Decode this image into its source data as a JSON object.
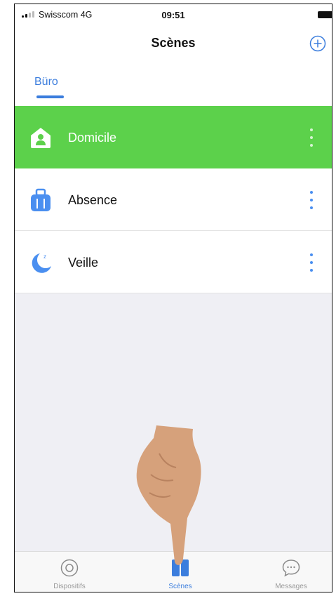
{
  "status_bar": {
    "carrier": "Swisscom  4G",
    "time": "09:51"
  },
  "header": {
    "title": "Scènes",
    "add_icon": "plus-circle-icon"
  },
  "tabs": [
    {
      "label": "Büro",
      "selected": true
    }
  ],
  "scenes": [
    {
      "label": "Domicile",
      "icon": "home-person-icon",
      "active": true
    },
    {
      "label": "Absence",
      "icon": "suitcase-icon",
      "active": false
    },
    {
      "label": "Veille",
      "icon": "moon-sleep-icon",
      "active": false
    }
  ],
  "tab_bar": [
    {
      "label": "Dispositifs",
      "icon": "devices-icon",
      "selected": false
    },
    {
      "label": "Scènes",
      "icon": "scenes-icon",
      "selected": true
    },
    {
      "label": "Messages",
      "icon": "chat-bubble-icon",
      "selected": false
    }
  ],
  "colors": {
    "accent": "#3b7ddd",
    "active_row": "#5cd14b",
    "background": "#efeff4",
    "icon_blue": "#4a8ff0"
  }
}
